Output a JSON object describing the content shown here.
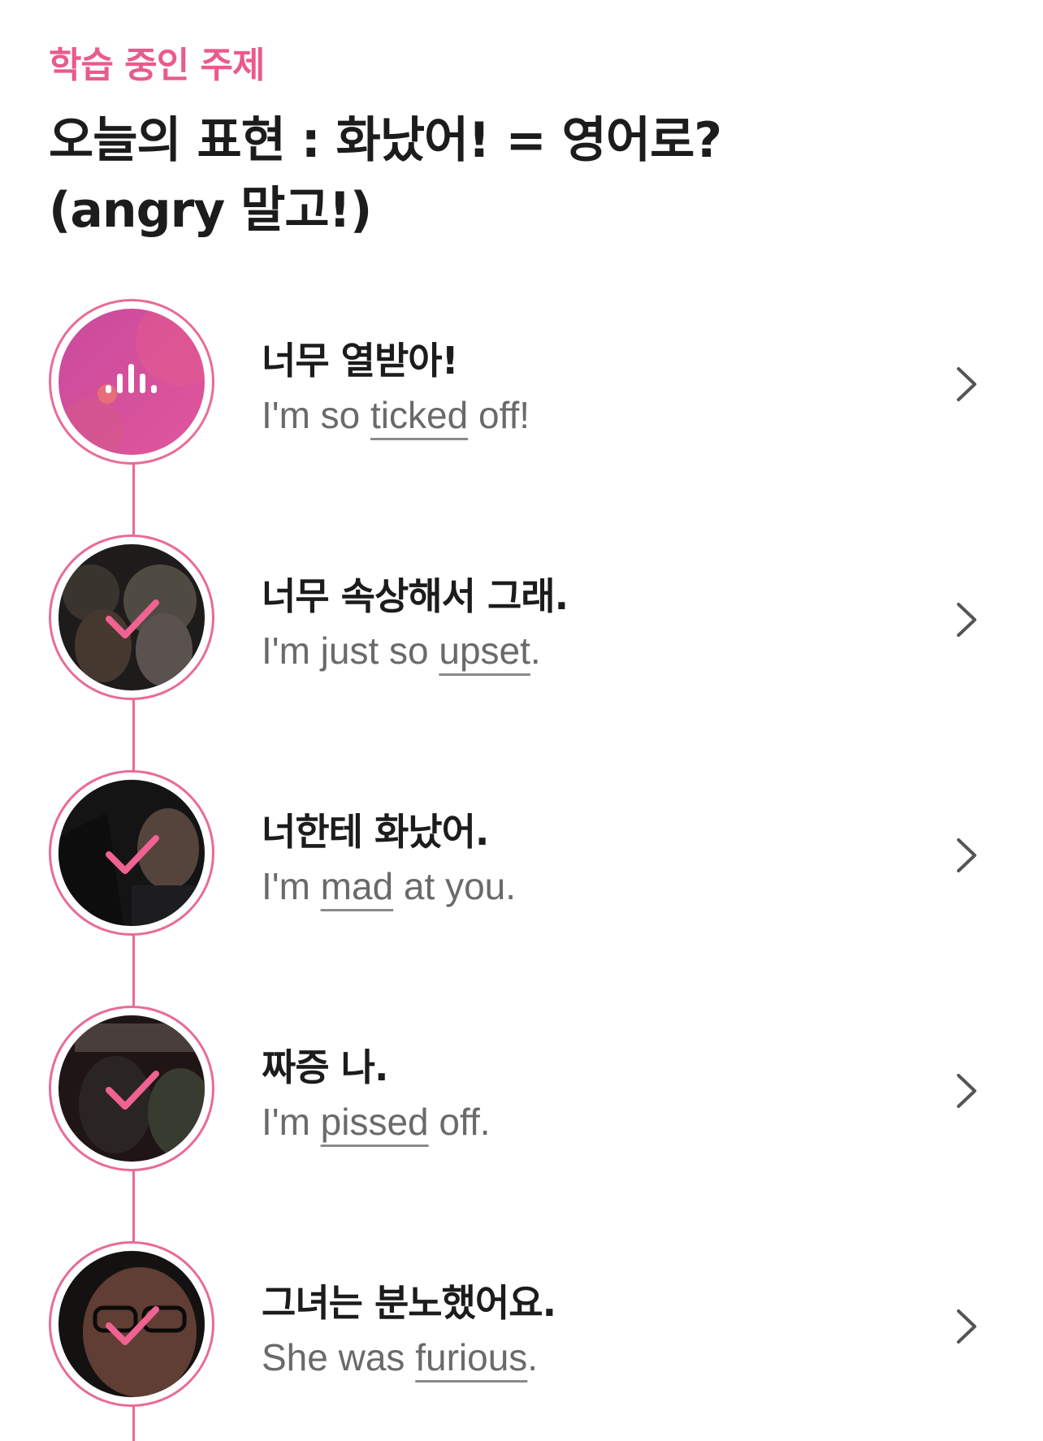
{
  "header": {
    "section_label": "학습 중인 주제",
    "topic_title_line1": "오늘의 표현 : 화났어! = 영어로?",
    "topic_title_line2": "(angry 말고!)"
  },
  "accent_color": "#e96b96",
  "expressions": [
    {
      "korean": "너무 열받아!",
      "english_before": "I'm so ",
      "english_keyword": "ticked",
      "english_after": " off!",
      "status": "now-playing",
      "thumb_icon": "audio-playing-icon"
    },
    {
      "korean": "너무 속상해서 그래.",
      "english_before": "I'm just so ",
      "english_keyword": "upset",
      "english_after": ".",
      "status": "completed",
      "thumb_icon": "check-icon"
    },
    {
      "korean": "너한테 화났어.",
      "english_before": "I'm ",
      "english_keyword": "mad",
      "english_after": " at you.",
      "status": "completed",
      "thumb_icon": "check-icon"
    },
    {
      "korean": "짜증 나.",
      "english_before": "I'm ",
      "english_keyword": "pissed",
      "english_after": " off.",
      "status": "completed",
      "thumb_icon": "check-icon"
    },
    {
      "korean": "그녀는 분노했어요.",
      "english_before": "She was ",
      "english_keyword": "furious",
      "english_after": ".",
      "status": "completed",
      "thumb_icon": "check-icon"
    }
  ]
}
